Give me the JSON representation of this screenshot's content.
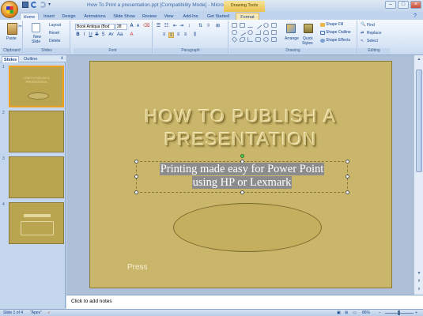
{
  "window": {
    "title": "How To Print a presentation.ppt [Compatibility Mode] - Microsoft PowerPoint",
    "context_tools": "Drawing Tools"
  },
  "quick_access": {
    "icons": [
      "save-icon",
      "undo-icon",
      "redo-icon",
      "customize-icon"
    ]
  },
  "tabs": [
    "Home",
    "Insert",
    "Design",
    "Animations",
    "Slide Show",
    "Review",
    "View",
    "Add-Ins",
    "Get Started",
    "Format"
  ],
  "ribbon": {
    "clipboard": {
      "label": "Clipboard",
      "paste": "Paste"
    },
    "slides": {
      "label": "Slides",
      "new_slide": "New",
      "new_slide2": "Slide",
      "layout": "Layout",
      "reset": "Reset",
      "delete": "Delete"
    },
    "font": {
      "label": "Font",
      "font_name": "Book Antiqua (Bod",
      "font_size": "28"
    },
    "paragraph": {
      "label": "Paragraph"
    },
    "drawing": {
      "label": "Drawing",
      "arrange": "Arrange",
      "quick_styles": "Quick",
      "quick_styles2": "Styles",
      "shape_fill": "Shape Fill",
      "shape_outline": "Shape Outline",
      "shape_effects": "Shape Effects"
    },
    "editing": {
      "label": "Editing",
      "find": "Find",
      "replace": "Replace",
      "select": "Select"
    }
  },
  "panel": {
    "tabs": [
      "Slides",
      "Outline"
    ],
    "close": "x",
    "slide_numbers": [
      "1",
      "2",
      "3",
      "4"
    ]
  },
  "slide": {
    "title_line1": "HOW TO PUBLISH A",
    "title_line2": "PRESENTATION",
    "subtitle_line1": "Printing made easy for Power Point",
    "subtitle_line2": "using HP or Lexmark",
    "press": "Press"
  },
  "notes": {
    "placeholder": "Click to add notes"
  },
  "status": {
    "slide": "Slide 1 of 4",
    "theme": "\"Apex\"",
    "zoom": "86%"
  },
  "colors": {
    "slide_bg": "#c9b66a",
    "ribbon_accent": "#15428b",
    "context_tab": "#eac14e"
  }
}
